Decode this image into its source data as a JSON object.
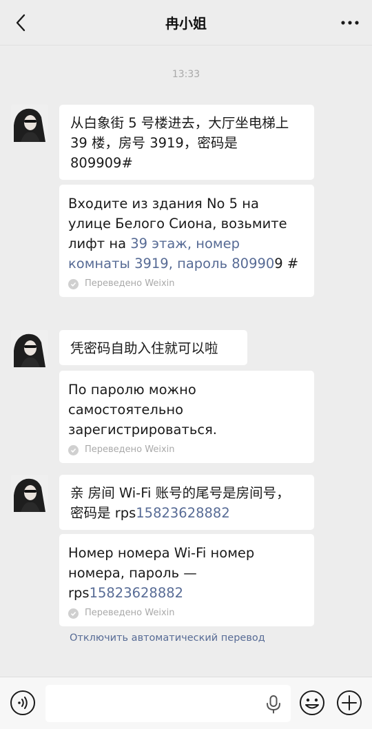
{
  "header": {
    "title": "冉小姐"
  },
  "timestamp": "13:33",
  "messages": [
    {
      "original": "从白象街 5 号楼进去，大厅坐电梯上39 楼，房号 3919，密码是 809909#",
      "translation": {
        "plain": "Входите из здания No 5 на улице Белого Сиона, возьмите лифт на ",
        "highlight": "39 этаж, номер комнаты 3919, пароль 80990",
        "tail": "9 #"
      },
      "note": "Переведено Weixin"
    },
    {
      "original": "凭密码自助入住就可以啦",
      "translation": {
        "plain": "По паролю можно самостоятельно зарегистрироваться.",
        "highlight": "",
        "tail": ""
      },
      "note": "Переведено Weixin"
    },
    {
      "original_plain": "亲 房间 Wi-Fi 账号的尾号是房间号，密码是 rps",
      "original_highlight": "15823628882",
      "translation": {
        "plain": "Номер номера Wi-Fi номер номера, пароль — rps",
        "highlight": "15823628882",
        "tail": ""
      },
      "note": "Переведено Weixin"
    }
  ],
  "disable_translation": "Отключить автоматический перевод",
  "input": {
    "value": ""
  },
  "colors": {
    "link": "#576b95",
    "background": "#ededed",
    "bubble": "#ffffff"
  },
  "icons": [
    "back-arrow-icon",
    "more-dots-icon",
    "voice-icon",
    "microphone-icon",
    "emoji-icon",
    "plus-icon",
    "check-icon"
  ]
}
